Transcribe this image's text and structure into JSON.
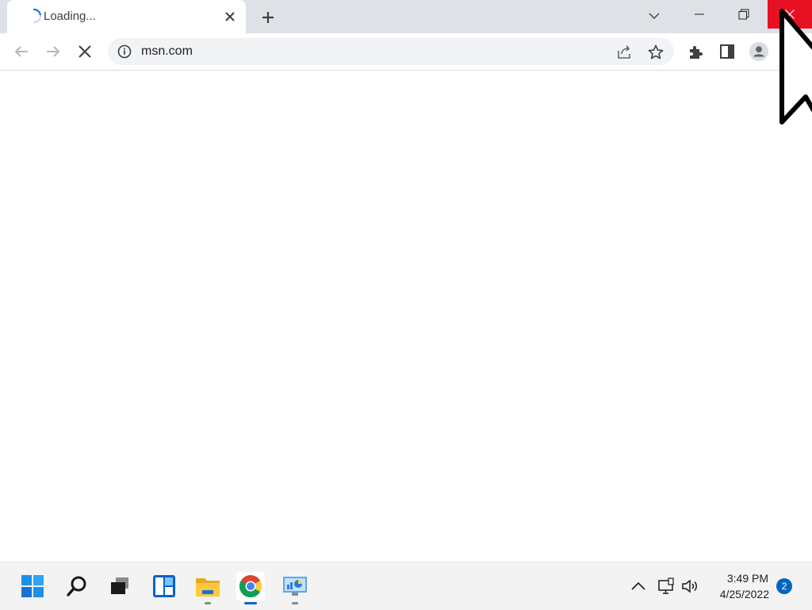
{
  "browser": {
    "tab": {
      "title": "Loading..."
    },
    "omnibox": {
      "url": "msn.com"
    }
  },
  "window_controls": {
    "close_hover_color": "#e81123"
  },
  "taskbar": {
    "apps": [
      "start-icon",
      "search-icon",
      "task-view-icon",
      "widgets-icon",
      "file-explorer-icon",
      "chrome-icon",
      "control-panel-icon"
    ],
    "active_app": "chrome-icon",
    "clock": {
      "time": "3:49 PM",
      "date": "4/25/2022"
    },
    "notifications": "2"
  },
  "colors": {
    "accent": "#0067c0",
    "tabstrip": "#dee1e6"
  }
}
